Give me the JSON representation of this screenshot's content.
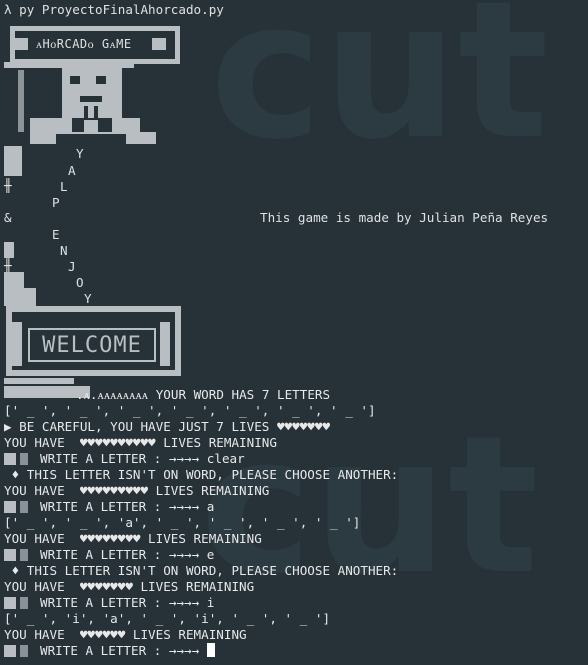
{
  "window": {
    "command_line": "λ py ProyectoFinalAhorcado.py"
  },
  "banner": {
    "title": "ᴀHᴏRCADᴏ GᴀME"
  },
  "vertical_word": [
    "Y",
    "A",
    "L",
    "P",
    "&",
    "E",
    "N",
    "J",
    "O",
    "Y"
  ],
  "credit": "This game is made by Julian Peña Reyes",
  "welcome": {
    "text": "WELCOME"
  },
  "output_lines": [
    {
      "text": ".ᴀ.ᴀᴀᴀᴀᴀᴀᴀᴀ YOUR WORD HAS 7 LETTERS"
    },
    {
      "text": "[' _ ', ' _ ', ' _ ', ' _ ', ' _ ', ' _ ', ' _ ']"
    },
    {
      "text": "▶ BE CAREFUL, YOU HAVE JUST 7 LIVES ♥♥♥♥♥♥♥"
    },
    {
      "text": "YOU HAVE  ♥♥♥♥♥♥♥♥♥♥ LIVES REMAINING"
    },
    {
      "text": "WRITE A LETTER : →→→→ clear",
      "box": true
    },
    {
      "text": " ♦ THIS LETTER ISN'T ON WORD, PLEASE CHOOSE ANOTHER:"
    },
    {
      "text": "YOU HAVE  ♥♥♥♥♥♥♥♥♥ LIVES REMAINING"
    },
    {
      "text": "WRITE A LETTER : →→→→ a",
      "box": true
    },
    {
      "text": "[' _ ', ' _ ', 'a', ' _ ', ' _ ', ' _ ', ' _ ']"
    },
    {
      "text": "YOU HAVE  ♥♥♥♥♥♥♥♥ LIVES REMAINING"
    },
    {
      "text": "WRITE A LETTER : →→→→ e",
      "box": true
    },
    {
      "text": " ♦ THIS LETTER ISN'T ON WORD, PLEASE CHOOSE ANOTHER:"
    },
    {
      "text": "YOU HAVE  ♥♥♥♥♥♥♥ LIVES REMAINING"
    },
    {
      "text": "WRITE A LETTER : →→→→ i",
      "box": true
    },
    {
      "text": "[' _ ', 'i', 'a', ' _ ', 'i', ' _ ', ' _ ']"
    },
    {
      "text": "YOU HAVE  ♥♥♥♥♥♥ LIVES REMAINING"
    },
    {
      "text": "WRITE A LETTER : →→→→ ",
      "box": true,
      "cursor": true
    }
  ],
  "colors": {
    "background": "#263238",
    "text": "#e8e8e8",
    "art": "#b8bec2"
  }
}
